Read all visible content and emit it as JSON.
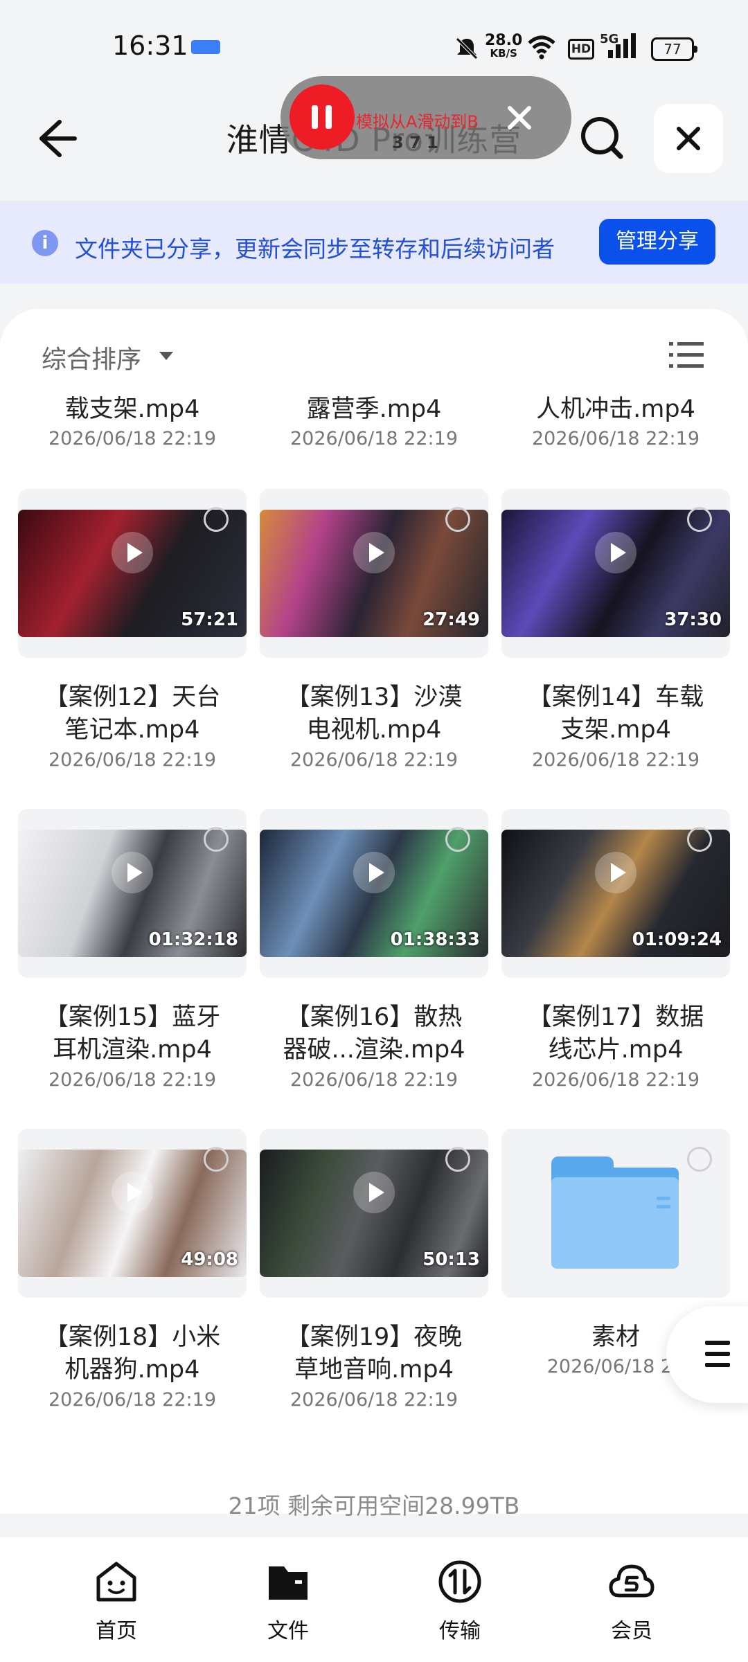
{
  "status_bar": {
    "time": "16:31",
    "net_speed_value": "28.0",
    "net_speed_unit": "KB/S",
    "hd": "HD",
    "network": "5G",
    "battery": "77"
  },
  "header": {
    "title": "淮情C4D Pro训练营"
  },
  "overlay": {
    "text": "模拟从A滑动到B",
    "sub": "3 7 1"
  },
  "banner": {
    "text": "文件夹已分享，更新会同步至转存和后续访问者",
    "button": "管理分享"
  },
  "toolbar": {
    "sort_label": "综合排序"
  },
  "top_row": [
    {
      "name": "载支架.mp4",
      "date": "2026/06/18 22:19"
    },
    {
      "name": "露营季.mp4",
      "date": "2026/06/18 22:19"
    },
    {
      "name": "人机冲击.mp4",
      "date": "2026/06/18 22:19"
    }
  ],
  "files": [
    {
      "line1": "【案例12】天台",
      "line2": "笔记本.mp4",
      "date": "2026/06/18 22:19",
      "duration": "57:21"
    },
    {
      "line1": "【案例13】沙漠",
      "line2": "电视机.mp4",
      "date": "2026/06/18 22:19",
      "duration": "27:49"
    },
    {
      "line1": "【案例14】车载",
      "line2": "支架.mp4",
      "date": "2026/06/18 22:19",
      "duration": "37:30"
    },
    {
      "line1": "【案例15】蓝牙",
      "line2": "耳机渲染.mp4",
      "date": "2026/06/18 22:19",
      "duration": "01:32:18"
    },
    {
      "line1": "【案例16】散热",
      "line2": "器破...渲染.mp4",
      "date": "2026/06/18 22:19",
      "duration": "01:38:33"
    },
    {
      "line1": "【案例17】数据",
      "line2": "线芯片.mp4",
      "date": "2026/06/18 22:19",
      "duration": "01:09:24"
    },
    {
      "line1": "【案例18】小米",
      "line2": "机器狗.mp4",
      "date": "2026/06/18 22:19",
      "duration": "49:08"
    },
    {
      "line1": "【案例19】夜晚",
      "line2": "草地音响.mp4",
      "date": "2026/06/18 22:19",
      "duration": "50:13"
    }
  ],
  "folder": {
    "name": "素材",
    "date": "2026/06/18 22"
  },
  "summary": "21项 剩余可用空间28.99TB",
  "nav": {
    "home": "首页",
    "files": "文件",
    "transfer": "传输",
    "member": "会员"
  }
}
